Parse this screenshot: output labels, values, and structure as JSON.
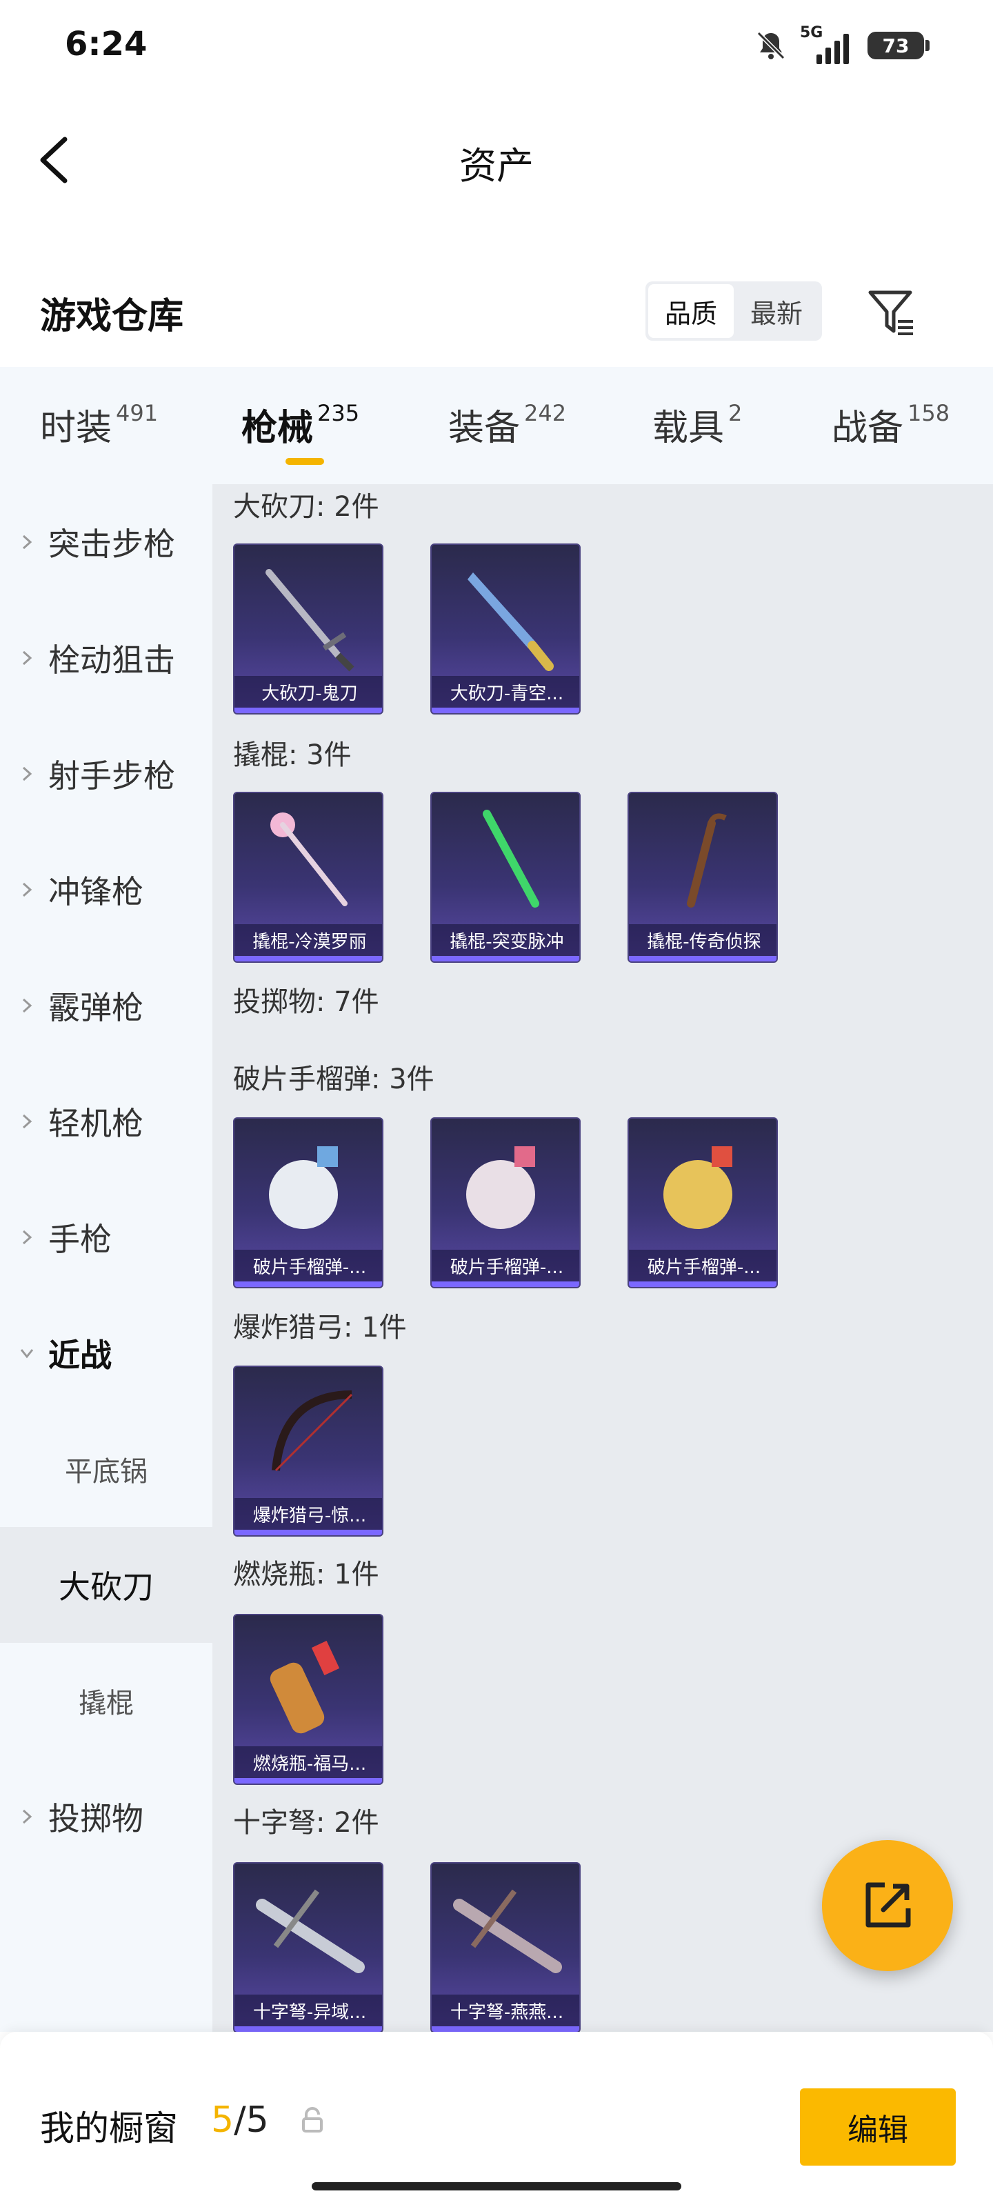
{
  "status": {
    "time": "6:24",
    "network": "5G",
    "battery": "73"
  },
  "header": {
    "title": "资产"
  },
  "warehouse": {
    "title": "游戏仓库",
    "sort": [
      "品质",
      "最新"
    ]
  },
  "tabs": [
    {
      "label": "时装",
      "count": "491"
    },
    {
      "label": "枪械",
      "count": "235"
    },
    {
      "label": "装备",
      "count": "242"
    },
    {
      "label": "载具",
      "count": "2"
    },
    {
      "label": "战备",
      "count": "158"
    }
  ],
  "sidebar": [
    {
      "label": "突击步枪"
    },
    {
      "label": "栓动狙击"
    },
    {
      "label": "射手步枪"
    },
    {
      "label": "冲锋枪"
    },
    {
      "label": "霰弹枪"
    },
    {
      "label": "轻机枪"
    },
    {
      "label": "手枪"
    },
    {
      "label": "近战"
    },
    {
      "label": "平底锅"
    },
    {
      "label": "大砍刀"
    },
    {
      "label": "撬棍"
    },
    {
      "label": "投掷物"
    }
  ],
  "sections": [
    {
      "title": "大砍刀: 2件",
      "items": [
        "大砍刀-鬼刀",
        "大砍刀-青空..."
      ]
    },
    {
      "title": "撬棍: 3件",
      "items": [
        "撬棍-冷漠罗丽",
        "撬棍-突变脉冲",
        "撬棍-传奇侦探"
      ]
    },
    {
      "title": "投掷物: 7件"
    },
    {
      "title": "破片手榴弹: 3件",
      "items": [
        "破片手榴弹-...",
        "破片手榴弹-...",
        "破片手榴弹-..."
      ]
    },
    {
      "title": "爆炸猎弓: 1件",
      "items": [
        "爆炸猎弓-惊..."
      ]
    },
    {
      "title": "燃烧瓶: 1件",
      "items": [
        "燃烧瓶-福马..."
      ]
    },
    {
      "title": "十字弩: 2件",
      "items": [
        "十字弩-异域...",
        "十字弩-燕燕..."
      ]
    }
  ],
  "bottom": {
    "title": "我的橱窗",
    "current": "5",
    "total": "/5",
    "edit": "编辑"
  },
  "colors": {
    "accent": "#f4b400",
    "card_bg": "#3a3473"
  }
}
